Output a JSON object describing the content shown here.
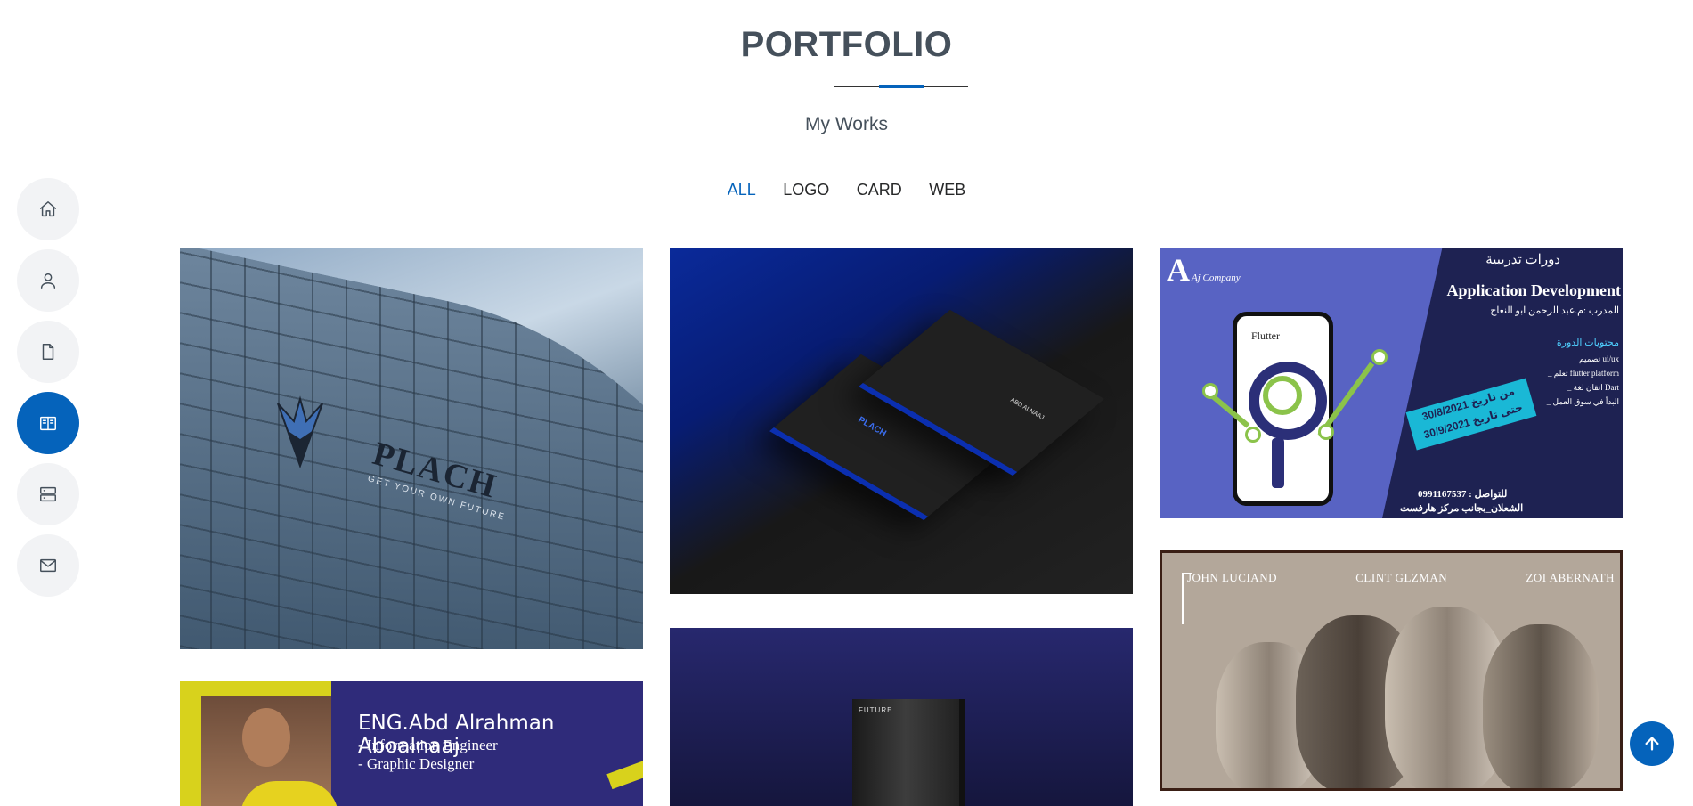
{
  "nav": {
    "items": [
      {
        "icon": "home-icon",
        "active": false
      },
      {
        "icon": "person-icon",
        "active": false
      },
      {
        "icon": "file-icon",
        "active": false
      },
      {
        "icon": "book-open-icon",
        "active": true
      },
      {
        "icon": "server-icon",
        "active": false
      },
      {
        "icon": "envelope-icon",
        "active": false
      }
    ]
  },
  "section": {
    "title": "PORTFOLIO",
    "subtitle": "My Works"
  },
  "filters": [
    {
      "label": "ALL",
      "active": true
    },
    {
      "label": "LOGO",
      "active": false
    },
    {
      "label": "CARD",
      "active": false
    },
    {
      "label": "WEB",
      "active": false
    }
  ],
  "portfolio": {
    "logo_building": {
      "brand": "PLACH",
      "tagline": "GET YOUR OWN FUTURE"
    },
    "business_card": {
      "brand": "PLACH",
      "name": "ABD ALNAAJ"
    },
    "flutter_course": {
      "company_initial": "A",
      "company_name": "Aj Company",
      "heading_ar": "دورات تدريبية",
      "title": "Application Development",
      "trainer": "المدرب :م.عبد الرحمن ابو النعاج",
      "contents_heading": "محتويات الدورة",
      "contents": [
        "_ تصميم ui/ux",
        "_ تعلم flutter platform",
        "_ اتقان لغة Dart",
        "_ البدأ في سوق العمل"
      ],
      "date_from": "من تاريخ 30/8/2021",
      "date_to": "حتى تاريخ 30/9/2021",
      "phone_text": "للتواصل : 0991167537",
      "location": "الشعلان_بجانب مركز هارفست",
      "phone_app": "Flutter"
    },
    "movie_poster": {
      "names": [
        "JOHN LUCIAND",
        "CLINT GLZMAN",
        "ZOI ABERNATH"
      ]
    },
    "engineer_card": {
      "name": "ENG.Abd Alrahman Aboalnaaj",
      "role1": "- Information Engineer",
      "role2": "- Graphic Designer"
    },
    "book": {
      "title": "FUTURE"
    }
  },
  "colors": {
    "accent": "#0563bb",
    "text": "#45505b",
    "nav_bg": "#f2f3f5"
  }
}
